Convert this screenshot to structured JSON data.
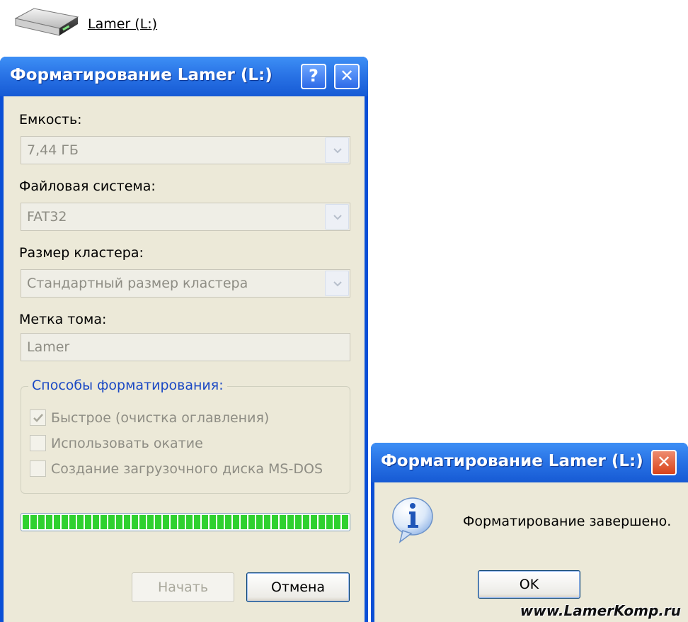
{
  "desktop": {
    "drive_icon": "drive-icon",
    "drive_label": "Lamer (L:)"
  },
  "format_dialog": {
    "title": "Форматирование Lamer (L:)",
    "help_button_label": "?",
    "close_button_label": "✕",
    "capacity": {
      "label": "Емкость:",
      "value": "7,44 ГБ"
    },
    "file_system": {
      "label": "Файловая система:",
      "value": "FAT32"
    },
    "cluster_size": {
      "label": "Размер кластера:",
      "value": "Стандартный размер кластера"
    },
    "volume_label": {
      "label": "Метка тома:",
      "value": "Lamer"
    },
    "format_options": {
      "legend": "Способы форматирования:",
      "options": [
        {
          "label": "Быстрое (очистка оглавления)",
          "checked": true
        },
        {
          "label": "Использовать окатие",
          "checked": false
        },
        {
          "label": "Создание загрузочного диска MS-DOS",
          "checked": false
        }
      ]
    },
    "progress": 1.0,
    "start_button_label": "Начать",
    "cancel_button_label": "Отмена"
  },
  "message_box": {
    "title": "Форматирование Lamer (L:)",
    "close_button_label": "✕",
    "icon": "info-icon",
    "message": "Форматирование завершено.",
    "ok_button_label": "OK"
  },
  "watermark": "www.LamerKomp.ru",
  "colors": {
    "titlebar": "#2a74e6",
    "dialog_body": "#ece9d8",
    "progress_fill": "#2fd12f",
    "close_red": "#d9431a"
  }
}
